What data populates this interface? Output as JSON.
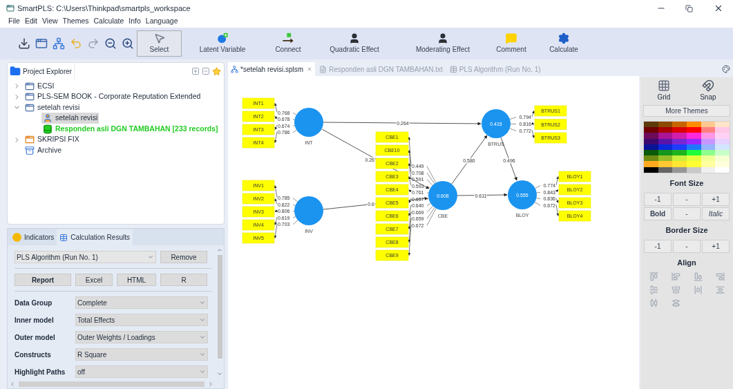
{
  "window": {
    "title": "SmartPLS: C:\\Users\\Thinkpad\\smartpls_workspace"
  },
  "menu": [
    "File",
    "Edit",
    "View",
    "Themes",
    "Calculate",
    "Info",
    "Language"
  ],
  "tools": [
    {
      "label": "Select",
      "selected": true
    },
    {
      "label": "Latent Variable",
      "selected": false
    },
    {
      "label": "Connect",
      "selected": false
    },
    {
      "label": "Quadratic Effect",
      "selected": false
    },
    {
      "label": "Moderating Effect",
      "selected": false
    },
    {
      "label": "Comment",
      "selected": false
    },
    {
      "label": "Calculate",
      "selected": false
    }
  ],
  "project_explorer": {
    "title": "Project Explorer",
    "items": [
      {
        "label": "ECSI",
        "kind": "project",
        "expanded": false,
        "selected": false
      },
      {
        "label": "PLS-SEM BOOK - Corporate Reputation Extended",
        "kind": "project",
        "expanded": false,
        "selected": false
      },
      {
        "label": "setelah revisi",
        "kind": "project",
        "expanded": true,
        "selected": false,
        "children": [
          {
            "label": "setelah revisi",
            "kind": "model",
            "selected": true
          },
          {
            "label": "Responden asli DGN TAMBAHAN [233 records]",
            "kind": "data",
            "selected": false
          }
        ]
      },
      {
        "label": "SKRIPSI FIX",
        "kind": "project-error",
        "expanded": false,
        "selected": false
      },
      {
        "label": "Archive",
        "kind": "archive",
        "selected": false
      }
    ]
  },
  "results_panel": {
    "tabs": [
      {
        "label": "Indicators",
        "selected": false
      },
      {
        "label": "Calculation Results",
        "selected": true
      }
    ],
    "run": "PLS Algorithm (Run No. 1)",
    "remove": "Remove",
    "exports": [
      "Report",
      "Excel",
      "HTML",
      "R"
    ],
    "settings": [
      {
        "label": "Data Group",
        "value": "Complete"
      },
      {
        "label": "Inner model",
        "value": "Total Effects"
      },
      {
        "label": "Outer model",
        "value": "Outer Weights / Loadings"
      },
      {
        "label": "Constructs",
        "value": "R Square"
      },
      {
        "label": "Highlight Paths",
        "value": "off"
      }
    ]
  },
  "editor_tabs": [
    {
      "label": "*setelah revisi.splsm",
      "selected": true
    },
    {
      "label": "Responden asli DGN TAMBAHAN.txt",
      "selected": false
    },
    {
      "label": "PLS Algorithm (Run No. 1)",
      "selected": false
    }
  ],
  "model": {
    "constructs": [
      {
        "name": "INT",
        "indicators": [
          {
            "name": "INT1",
            "loading": "0.768"
          },
          {
            "name": "INT2",
            "loading": "0.678"
          },
          {
            "name": "INT3",
            "loading": "0.674"
          },
          {
            "name": "INT4",
            "loading": "0.786"
          }
        ]
      },
      {
        "name": "INV",
        "indicators": [
          {
            "name": "INV1",
            "loading": "0.785"
          },
          {
            "name": "INV2",
            "loading": "0.822"
          },
          {
            "name": "INV3",
            "loading": "0.806"
          },
          {
            "name": "INV4",
            "loading": "0.619"
          },
          {
            "name": "INV5",
            "loading": "0.703"
          }
        ]
      },
      {
        "name": "CBE",
        "value": "0.608",
        "indicators": [
          {
            "name": "CBE1",
            "loading": "0.449"
          },
          {
            "name": "CBE10",
            "loading": "0.708"
          },
          {
            "name": "CBE2",
            "loading": "0.591"
          },
          {
            "name": "CBE3",
            "loading": "0.593"
          },
          {
            "name": "CBE4",
            "loading": "0.761"
          },
          {
            "name": "CBE5",
            "loading": "0.657"
          },
          {
            "name": "CBE6",
            "loading": "0.640"
          },
          {
            "name": "CBE7",
            "loading": "0.669"
          },
          {
            "name": "CBE8",
            "loading": "0.659"
          },
          {
            "name": "CBE9",
            "loading": "0.672"
          }
        ]
      },
      {
        "name": "BTRUS",
        "value": "0.415",
        "indicators": [
          {
            "name": "BTRUS1",
            "loading": "0.794"
          },
          {
            "name": "BTRUS2",
            "loading": "0.816"
          },
          {
            "name": "BTRUS3",
            "loading": "0.772"
          }
        ]
      },
      {
        "name": "BLOY",
        "value": "0.555",
        "indicators": [
          {
            "name": "BLOY1",
            "loading": "0.774"
          },
          {
            "name": "BLOY2",
            "loading": "0.843"
          },
          {
            "name": "BLOY3",
            "loading": "0.836"
          },
          {
            "name": "BLOY4",
            "loading": "0.672"
          }
        ]
      }
    ],
    "paths": [
      {
        "coefficient": "0.264"
      },
      {
        "coefficient": "0.26"
      },
      {
        "coefficient": "0.6"
      },
      {
        "coefficient": "0.580"
      },
      {
        "coefficient": "0.496"
      },
      {
        "coefficient": "0.611"
      }
    ]
  },
  "themes_panel": {
    "tools": [
      "Grid",
      "Snap"
    ],
    "more_themes": "More Themes",
    "palette": [
      {
        "color": "#5c3a0a"
      },
      {
        "color": "#8b4a00"
      },
      {
        "color": "#c86400"
      },
      {
        "color": "#ff8c00"
      },
      {
        "color": "#ffc890"
      },
      {
        "color": "#ffe4c8"
      },
      {
        "color": "#6e0000"
      },
      {
        "color": "#aa0000"
      },
      {
        "color": "#dd0000"
      },
      {
        "color": "#ff0000"
      },
      {
        "color": "#ff8080"
      },
      {
        "color": "#ffc8e6"
      },
      {
        "color": "#6e0a5a"
      },
      {
        "color": "#aa1496"
      },
      {
        "color": "#d21eaa"
      },
      {
        "color": "#ff28dc"
      },
      {
        "color": "#ff96e6"
      },
      {
        "color": "#ffd2f5"
      },
      {
        "color": "#3c0a6e"
      },
      {
        "color": "#5a14aa"
      },
      {
        "color": "#7828d2"
      },
      {
        "color": "#9628ff"
      },
      {
        "color": "#c896ff"
      },
      {
        "color": "#e6d2ff"
      },
      {
        "color": "#0a1496"
      },
      {
        "color": "#0a28dc"
      },
      {
        "color": "#1e3cff"
      },
      {
        "color": "#1e78ff"
      },
      {
        "color": "#96b4ff"
      },
      {
        "color": "#d2e6ff"
      },
      {
        "color": "#0a5a0a"
      },
      {
        "color": "#14961e"
      },
      {
        "color": "#1eb41e"
      },
      {
        "color": "#1eff3c"
      },
      {
        "color": "#8cff8c"
      },
      {
        "color": "#c8ffc8"
      },
      {
        "color": "#6e8c14"
      },
      {
        "color": "#96be28"
      },
      {
        "color": "#c8f03c"
      },
      {
        "color": "#e6ff3c"
      },
      {
        "color": "#f0ff96"
      },
      {
        "color": "#f5ffd2"
      },
      {
        "color": "#ffaa1e"
      },
      {
        "color": "#ffc832"
      },
      {
        "color": "#ffe632"
      },
      {
        "color": "#ffff32"
      },
      {
        "color": "#ffffa0"
      },
      {
        "color": "#ffffdc"
      },
      {
        "color": "#000000"
      },
      {
        "color": "#646464"
      },
      {
        "color": "#969696"
      },
      {
        "color": "#c8c8c8"
      },
      {
        "color": "#f0f0f0"
      },
      {
        "color": "#ffffff"
      }
    ],
    "font_size": {
      "title": "Font Size",
      "buttons": [
        "-1",
        "-",
        "+1",
        "Bold",
        "-",
        "Italic"
      ]
    },
    "border_size": {
      "title": "Border Size",
      "buttons": [
        "-1",
        "-",
        "+1"
      ]
    },
    "align": {
      "title": "Align"
    }
  }
}
